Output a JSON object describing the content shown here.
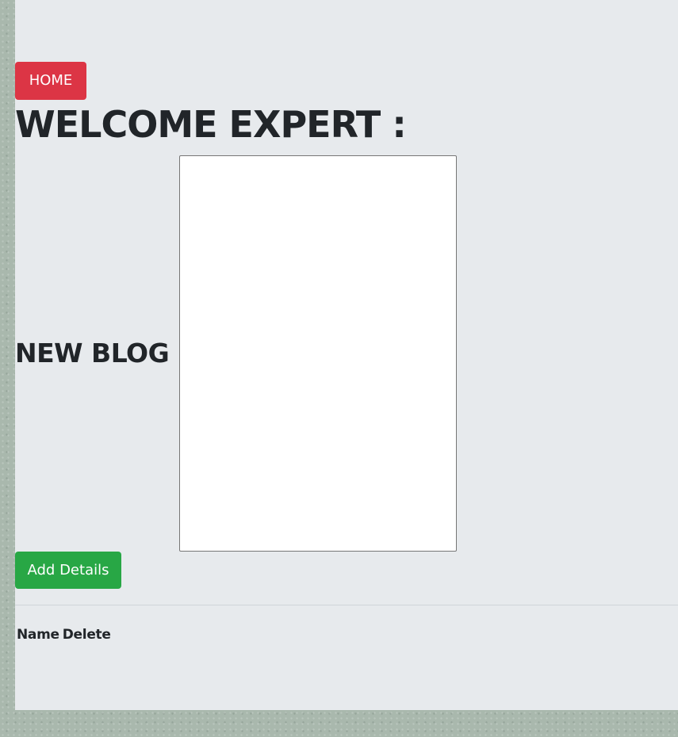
{
  "nav": {
    "home_label": "HOME"
  },
  "header": {
    "title": "WELCOME EXPERT :"
  },
  "blog_form": {
    "label": "NEW BLOG :",
    "textarea_value": "",
    "submit_label": "Add Details"
  },
  "table": {
    "columns": [
      "Name",
      "Delete"
    ]
  },
  "colors": {
    "home_button": "#dc3545",
    "add_button": "#28a745",
    "panel_background": "#e7eaed",
    "page_background": "#a9b8ad",
    "text": "#212529"
  }
}
